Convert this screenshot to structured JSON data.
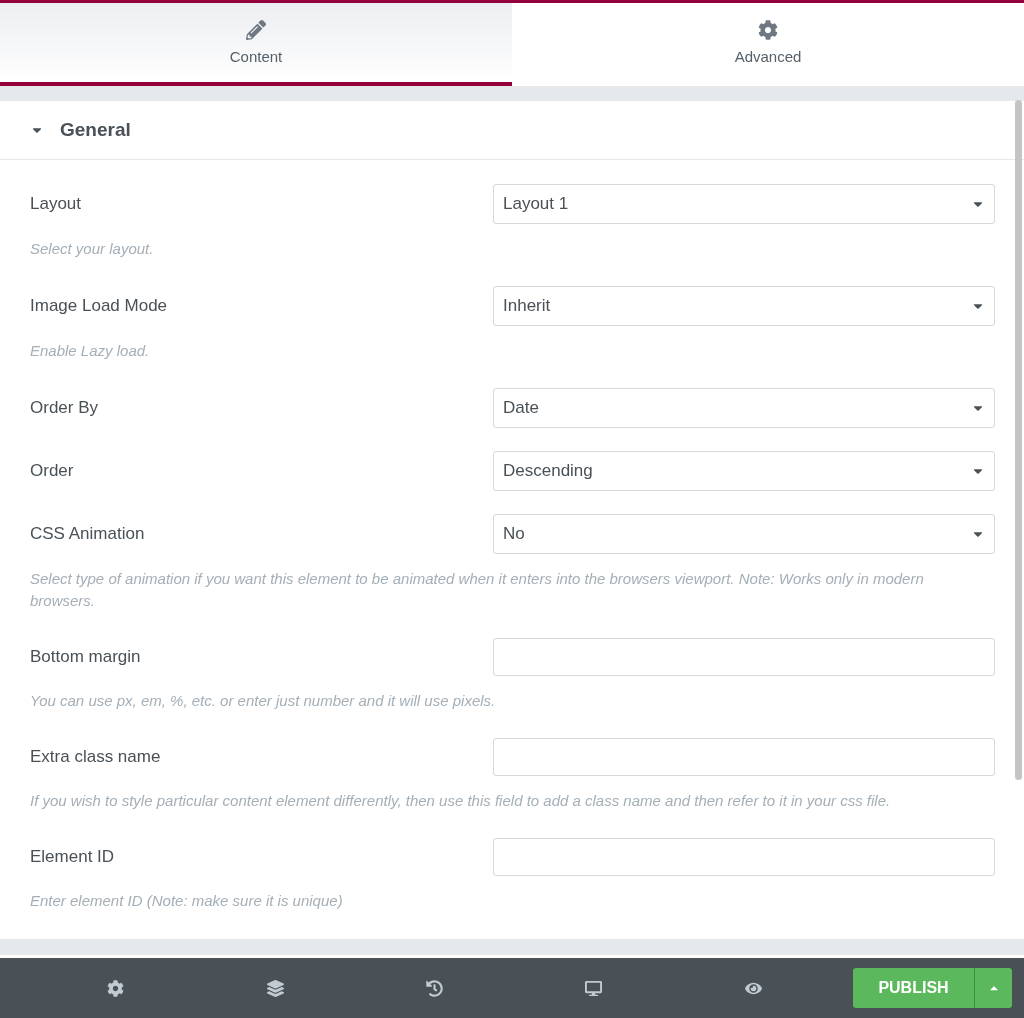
{
  "tabs": [
    {
      "label": "Content",
      "selected": true
    },
    {
      "label": "Advanced",
      "selected": false
    }
  ],
  "section": {
    "title": "General",
    "expanded": true
  },
  "fields": [
    {
      "kind": "select",
      "label": "Layout",
      "value": "Layout 1",
      "description": "Select your layout."
    },
    {
      "kind": "select",
      "label": "Image Load Mode",
      "value": "Inherit",
      "description": "Enable Lazy load."
    },
    {
      "kind": "select",
      "label": "Order By",
      "value": "Date"
    },
    {
      "kind": "select",
      "label": "Order",
      "value": "Descending"
    },
    {
      "kind": "select",
      "label": "CSS Animation",
      "value": "No",
      "description": "Select type of animation if you want this element to be animated when it enters into the browsers viewport. Note: Works only in modern browsers."
    },
    {
      "kind": "text",
      "label": "Bottom margin",
      "description": "You can use px, em, %, etc. or enter just number and it will use pixels."
    },
    {
      "kind": "text",
      "label": "Extra class name",
      "description": "If you wish to style particular content element differently, then use this field to add a class name and then refer to it in your css file."
    },
    {
      "kind": "text",
      "label": "Element ID",
      "description": "Enter element ID (Note: make sure it is unique)"
    }
  ],
  "footer": {
    "publish": "PUBLISH"
  }
}
